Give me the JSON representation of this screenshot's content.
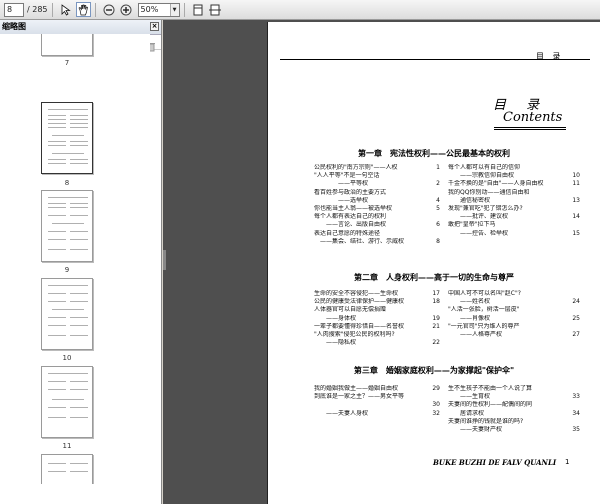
{
  "toolbar": {
    "page_current": "8",
    "page_total": "/ 285",
    "zoom": "50%"
  },
  "panel": {
    "title": "缩略图",
    "close": "×",
    "thumbnails": [
      {
        "label": "7"
      },
      {
        "label": "8"
      },
      {
        "label": "9"
      },
      {
        "label": "10"
      },
      {
        "label": "11"
      }
    ]
  },
  "page": {
    "header": "目  录",
    "title_cn": "目 录",
    "title_en": "Contents",
    "chapters": [
      {
        "title": "第一章　宪法性权利——公民最基本的权利",
        "left": [
          [
            "公民权利的\"南方宗则\"——人权",
            "1"
          ],
          [
            "\"人人平等\"不是一句空话",
            ""
          ],
          [
            "　　　　——平等权",
            "2"
          ],
          [
            "看百姓参与政治的主要方式",
            ""
          ],
          [
            "　　　　——选举权",
            "4"
          ],
          [
            "你也能当主人翁——被选举权",
            "5"
          ],
          [
            "每个人都有表达自己的权利",
            ""
          ],
          [
            "　　——言论、出版自由权",
            "6"
          ],
          [
            "表达自己意愿的特殊途径",
            ""
          ],
          [
            "　——集会、结社、游行、示威权",
            "8"
          ]
        ],
        "right": [
          [
            "每个人都可以有自己的信仰",
            ""
          ],
          [
            "　　——宗教信仰自由权",
            "10"
          ],
          [
            "千金不换的是\"自由\"——人身自由权",
            "11"
          ],
          [
            "我的QQ你别动——通信自由和",
            ""
          ],
          [
            "　　通信秘密权",
            "13"
          ],
          [
            "发现\"兼官吃\"犯了错怎么办?",
            ""
          ],
          [
            "　　——批评、建议权",
            "14"
          ],
          [
            "敢把\"皇帝\"拉下马",
            ""
          ],
          [
            "　　——控告、检举权",
            "15"
          ]
        ]
      },
      {
        "title": "第二章　人身权利——高于一切的生命与尊严",
        "left": [
          [
            "生命的安全不容侵犯——生命权",
            "17"
          ],
          [
            "公民的健康受法律保护——健康权",
            "18"
          ],
          [
            "人体器官可以自愿无偿捐赠",
            ""
          ],
          [
            "　　——身体权",
            "19"
          ],
          [
            "一辈子都要懂得珍惜自——名誉权",
            "21"
          ],
          [
            "\"人肉搜索\"侵犯公民的权利吗?",
            ""
          ],
          [
            "　　——隐私权",
            "22"
          ]
        ],
        "right": [
          [
            "中国人可不可以名叫\"赵C\"?",
            ""
          ],
          [
            "　　——姓名权",
            "24"
          ],
          [
            "\"人活一张脸，树活一层皮\"",
            ""
          ],
          [
            "　　——肖像权",
            "25"
          ],
          [
            "\"一元官司\"只为维人的尊严",
            ""
          ],
          [
            "　　——人格尊严权",
            "27"
          ]
        ]
      },
      {
        "title": "第三章　婚姻家庭权利——为家撑起\"保护伞\"",
        "left": [
          [
            "我的婚姻我做主——婚姻自由权",
            "29"
          ],
          [
            "到底谁是一家之主？——男女平等",
            ""
          ],
          [
            "　　　　　　　　　　　　　　　",
            "30"
          ],
          [
            "　　——夫妻人身权",
            "32"
          ]
        ],
        "right": [
          [
            "生不生孩子不能由一个人说了算",
            ""
          ],
          [
            "　　——生育权",
            "33"
          ],
          [
            "夫妻间的性权利——配偶间的同",
            ""
          ],
          [
            "　　居请求权",
            "34"
          ],
          [
            "夫妻间谁挣的钱就是谁的吗?",
            ""
          ],
          [
            "　　——夫妻财产权",
            "35"
          ]
        ]
      }
    ],
    "footer": "BUKE BUZHI DE FALV QUANLI",
    "page_number": "1"
  }
}
